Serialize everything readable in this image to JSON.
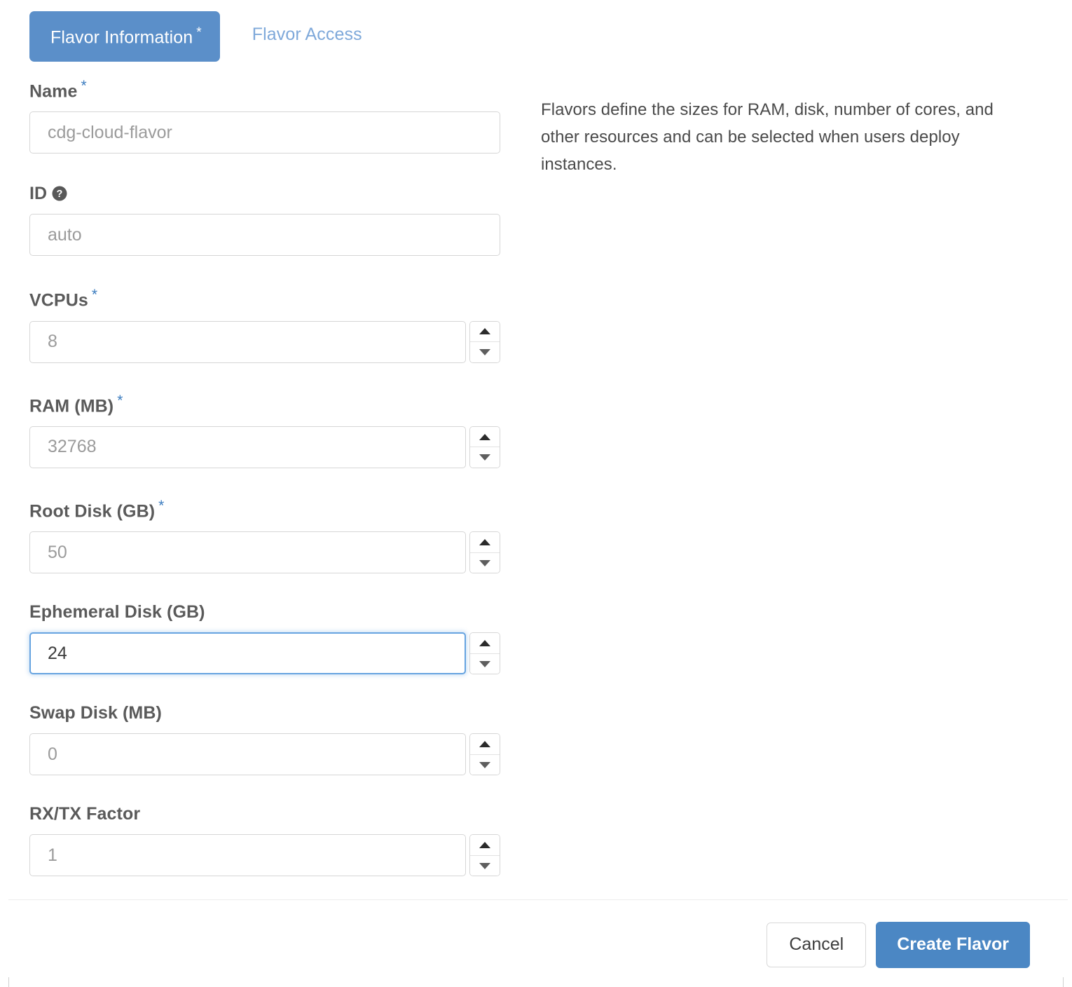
{
  "tabs": [
    {
      "label": "Flavor Information",
      "required_marker": "*",
      "active": true
    },
    {
      "label": "Flavor Access",
      "required_marker": "",
      "active": false
    }
  ],
  "form": {
    "fields": [
      {
        "key": "name",
        "label": "Name",
        "required_marker": "*",
        "value": "cdg-cloud-flavor",
        "type": "text",
        "has_spinner": false,
        "focused": false,
        "has_help_icon": false
      },
      {
        "key": "id",
        "label": "ID",
        "required_marker": "",
        "value": "auto",
        "type": "text",
        "has_spinner": false,
        "focused": false,
        "has_help_icon": true,
        "help_icon": "question-circle-icon"
      },
      {
        "key": "vcpus",
        "label": "VCPUs",
        "required_marker": "*",
        "value": "8",
        "type": "number",
        "has_spinner": true,
        "focused": false,
        "has_help_icon": false
      },
      {
        "key": "ram",
        "label": "RAM (MB)",
        "required_marker": "*",
        "value": "32768",
        "type": "number",
        "has_spinner": true,
        "focused": false,
        "has_help_icon": false
      },
      {
        "key": "root_disk",
        "label": "Root Disk (GB)",
        "required_marker": "*",
        "value": "50",
        "type": "number",
        "has_spinner": true,
        "focused": false,
        "has_help_icon": false
      },
      {
        "key": "ephemeral_disk",
        "label": "Ephemeral Disk (GB)",
        "required_marker": "",
        "value": "24",
        "type": "number",
        "has_spinner": true,
        "focused": true,
        "has_help_icon": false
      },
      {
        "key": "swap_disk",
        "label": "Swap Disk (MB)",
        "required_marker": "",
        "value": "0",
        "type": "number",
        "has_spinner": true,
        "focused": false,
        "has_help_icon": false
      },
      {
        "key": "rxtx_factor",
        "label": "RX/TX Factor",
        "required_marker": "",
        "value": "1",
        "type": "number",
        "has_spinner": true,
        "focused": false,
        "has_help_icon": false
      }
    ]
  },
  "description": "Flavors define the sizes for RAM, disk, number of cores, and other resources and can be selected when users deploy instances.",
  "footer": {
    "cancel_label": "Cancel",
    "submit_label": "Create Flavor"
  },
  "colors": {
    "tab_active_bg": "#5b8fc9",
    "tab_inactive_text": "#7fa9da",
    "required_asterisk": "#3b7cbf",
    "primary_button_bg": "#4b87c4",
    "focus_border": "#66a3e0",
    "label_text": "#5a5a5a",
    "input_placeholder": "#9b9b9b",
    "input_value_focused": "#3c3c3c",
    "input_border": "#d6d6d6",
    "divider": "#eeeeee"
  }
}
